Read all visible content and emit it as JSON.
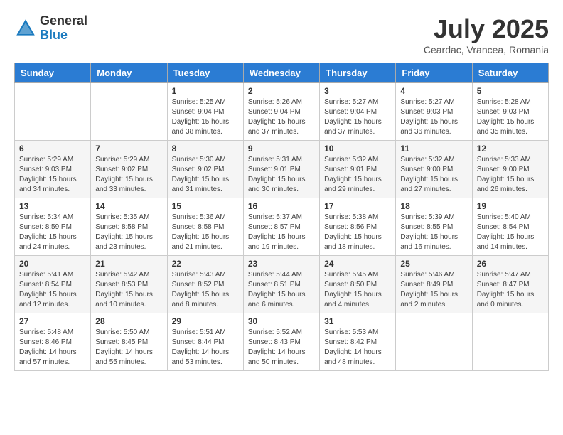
{
  "header": {
    "logo_general": "General",
    "logo_blue": "Blue",
    "month_year": "July 2025",
    "location": "Ceardac, Vrancea, Romania"
  },
  "weekdays": [
    "Sunday",
    "Monday",
    "Tuesday",
    "Wednesday",
    "Thursday",
    "Friday",
    "Saturday"
  ],
  "weeks": [
    [
      {
        "day": "",
        "detail": ""
      },
      {
        "day": "",
        "detail": ""
      },
      {
        "day": "1",
        "detail": "Sunrise: 5:25 AM\nSunset: 9:04 PM\nDaylight: 15 hours\nand 38 minutes."
      },
      {
        "day": "2",
        "detail": "Sunrise: 5:26 AM\nSunset: 9:04 PM\nDaylight: 15 hours\nand 37 minutes."
      },
      {
        "day": "3",
        "detail": "Sunrise: 5:27 AM\nSunset: 9:04 PM\nDaylight: 15 hours\nand 37 minutes."
      },
      {
        "day": "4",
        "detail": "Sunrise: 5:27 AM\nSunset: 9:03 PM\nDaylight: 15 hours\nand 36 minutes."
      },
      {
        "day": "5",
        "detail": "Sunrise: 5:28 AM\nSunset: 9:03 PM\nDaylight: 15 hours\nand 35 minutes."
      }
    ],
    [
      {
        "day": "6",
        "detail": "Sunrise: 5:29 AM\nSunset: 9:03 PM\nDaylight: 15 hours\nand 34 minutes."
      },
      {
        "day": "7",
        "detail": "Sunrise: 5:29 AM\nSunset: 9:02 PM\nDaylight: 15 hours\nand 33 minutes."
      },
      {
        "day": "8",
        "detail": "Sunrise: 5:30 AM\nSunset: 9:02 PM\nDaylight: 15 hours\nand 31 minutes."
      },
      {
        "day": "9",
        "detail": "Sunrise: 5:31 AM\nSunset: 9:01 PM\nDaylight: 15 hours\nand 30 minutes."
      },
      {
        "day": "10",
        "detail": "Sunrise: 5:32 AM\nSunset: 9:01 PM\nDaylight: 15 hours\nand 29 minutes."
      },
      {
        "day": "11",
        "detail": "Sunrise: 5:32 AM\nSunset: 9:00 PM\nDaylight: 15 hours\nand 27 minutes."
      },
      {
        "day": "12",
        "detail": "Sunrise: 5:33 AM\nSunset: 9:00 PM\nDaylight: 15 hours\nand 26 minutes."
      }
    ],
    [
      {
        "day": "13",
        "detail": "Sunrise: 5:34 AM\nSunset: 8:59 PM\nDaylight: 15 hours\nand 24 minutes."
      },
      {
        "day": "14",
        "detail": "Sunrise: 5:35 AM\nSunset: 8:58 PM\nDaylight: 15 hours\nand 23 minutes."
      },
      {
        "day": "15",
        "detail": "Sunrise: 5:36 AM\nSunset: 8:58 PM\nDaylight: 15 hours\nand 21 minutes."
      },
      {
        "day": "16",
        "detail": "Sunrise: 5:37 AM\nSunset: 8:57 PM\nDaylight: 15 hours\nand 19 minutes."
      },
      {
        "day": "17",
        "detail": "Sunrise: 5:38 AM\nSunset: 8:56 PM\nDaylight: 15 hours\nand 18 minutes."
      },
      {
        "day": "18",
        "detail": "Sunrise: 5:39 AM\nSunset: 8:55 PM\nDaylight: 15 hours\nand 16 minutes."
      },
      {
        "day": "19",
        "detail": "Sunrise: 5:40 AM\nSunset: 8:54 PM\nDaylight: 15 hours\nand 14 minutes."
      }
    ],
    [
      {
        "day": "20",
        "detail": "Sunrise: 5:41 AM\nSunset: 8:54 PM\nDaylight: 15 hours\nand 12 minutes."
      },
      {
        "day": "21",
        "detail": "Sunrise: 5:42 AM\nSunset: 8:53 PM\nDaylight: 15 hours\nand 10 minutes."
      },
      {
        "day": "22",
        "detail": "Sunrise: 5:43 AM\nSunset: 8:52 PM\nDaylight: 15 hours\nand 8 minutes."
      },
      {
        "day": "23",
        "detail": "Sunrise: 5:44 AM\nSunset: 8:51 PM\nDaylight: 15 hours\nand 6 minutes."
      },
      {
        "day": "24",
        "detail": "Sunrise: 5:45 AM\nSunset: 8:50 PM\nDaylight: 15 hours\nand 4 minutes."
      },
      {
        "day": "25",
        "detail": "Sunrise: 5:46 AM\nSunset: 8:49 PM\nDaylight: 15 hours\nand 2 minutes."
      },
      {
        "day": "26",
        "detail": "Sunrise: 5:47 AM\nSunset: 8:47 PM\nDaylight: 15 hours\nand 0 minutes."
      }
    ],
    [
      {
        "day": "27",
        "detail": "Sunrise: 5:48 AM\nSunset: 8:46 PM\nDaylight: 14 hours\nand 57 minutes."
      },
      {
        "day": "28",
        "detail": "Sunrise: 5:50 AM\nSunset: 8:45 PM\nDaylight: 14 hours\nand 55 minutes."
      },
      {
        "day": "29",
        "detail": "Sunrise: 5:51 AM\nSunset: 8:44 PM\nDaylight: 14 hours\nand 53 minutes."
      },
      {
        "day": "30",
        "detail": "Sunrise: 5:52 AM\nSunset: 8:43 PM\nDaylight: 14 hours\nand 50 minutes."
      },
      {
        "day": "31",
        "detail": "Sunrise: 5:53 AM\nSunset: 8:42 PM\nDaylight: 14 hours\nand 48 minutes."
      },
      {
        "day": "",
        "detail": ""
      },
      {
        "day": "",
        "detail": ""
      }
    ]
  ]
}
